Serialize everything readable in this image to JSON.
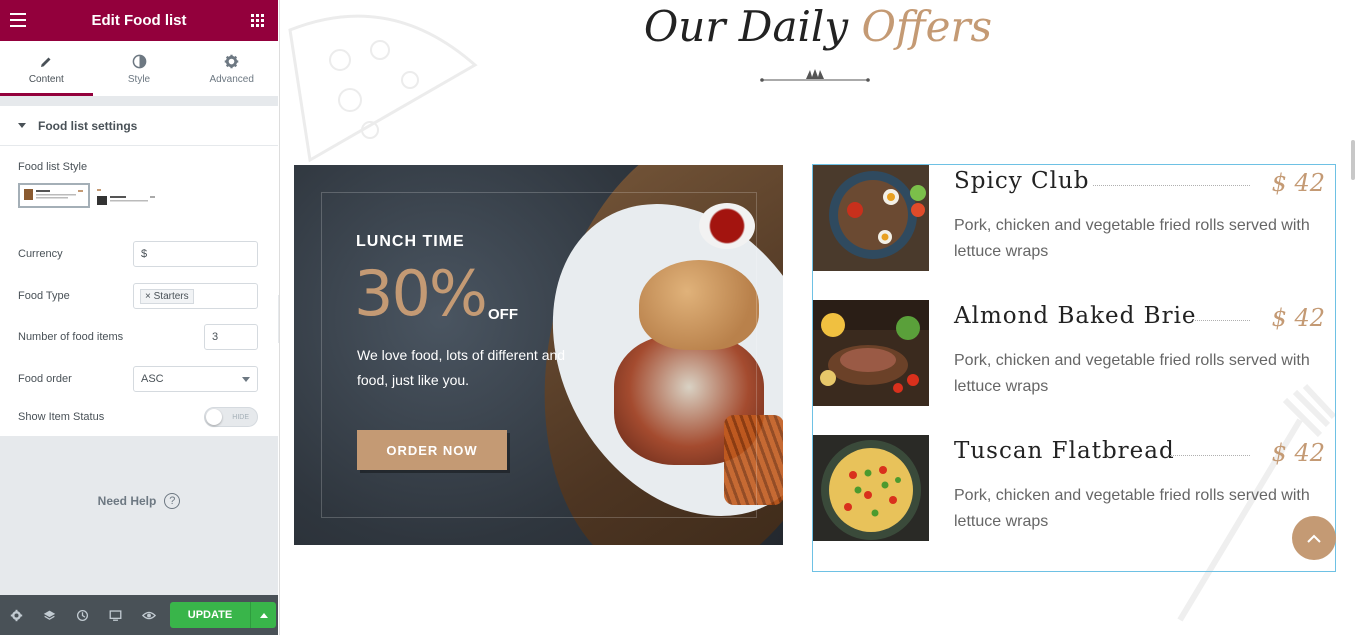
{
  "panel": {
    "title": "Edit Food list",
    "tabs": [
      {
        "label": "Content",
        "icon": "pencil-icon",
        "active": true
      },
      {
        "label": "Style",
        "icon": "half-circle-icon",
        "active": false
      },
      {
        "label": "Advanced",
        "icon": "gear-icon",
        "active": false
      }
    ],
    "section_title": "Food list settings",
    "fields": {
      "style_label": "Food list Style",
      "currency_label": "Currency",
      "currency_value": "$",
      "food_type_label": "Food Type",
      "food_type_tag": "Starters",
      "food_type_tag_remove": "×",
      "number_label": "Number of food items",
      "number_value": "3",
      "order_label": "Food order",
      "order_value": "ASC",
      "status_label": "Show Item Status",
      "status_toggle_text": "HIDE"
    },
    "help_text": "Need Help",
    "help_icon": "?",
    "update_label": "UPDATE",
    "accent_color": "#93003c",
    "update_color": "#39b54a"
  },
  "preview": {
    "heading_main": "Our Daily ",
    "heading_accent": "Offers",
    "accent_color": "#c49a74",
    "banner": {
      "eyebrow": "LUNCH TIME",
      "percent": "30%",
      "off": "OFF",
      "description": "We love food, lots of different and food, just like you.",
      "button": "ORDER NOW"
    },
    "items": [
      {
        "name": "Spicy Club",
        "price": "$ 42",
        "description": "Pork, chicken and vegetable fried rolls served with lettuce wraps"
      },
      {
        "name": "Almond Baked Brie",
        "price": "$ 42",
        "description": "Pork, chicken and vegetable fried rolls served with lettuce wraps"
      },
      {
        "name": "Tuscan Flatbread",
        "price": "$ 42",
        "description": "Pork, chicken and vegetable fried rolls served with lettuce wraps"
      }
    ]
  }
}
